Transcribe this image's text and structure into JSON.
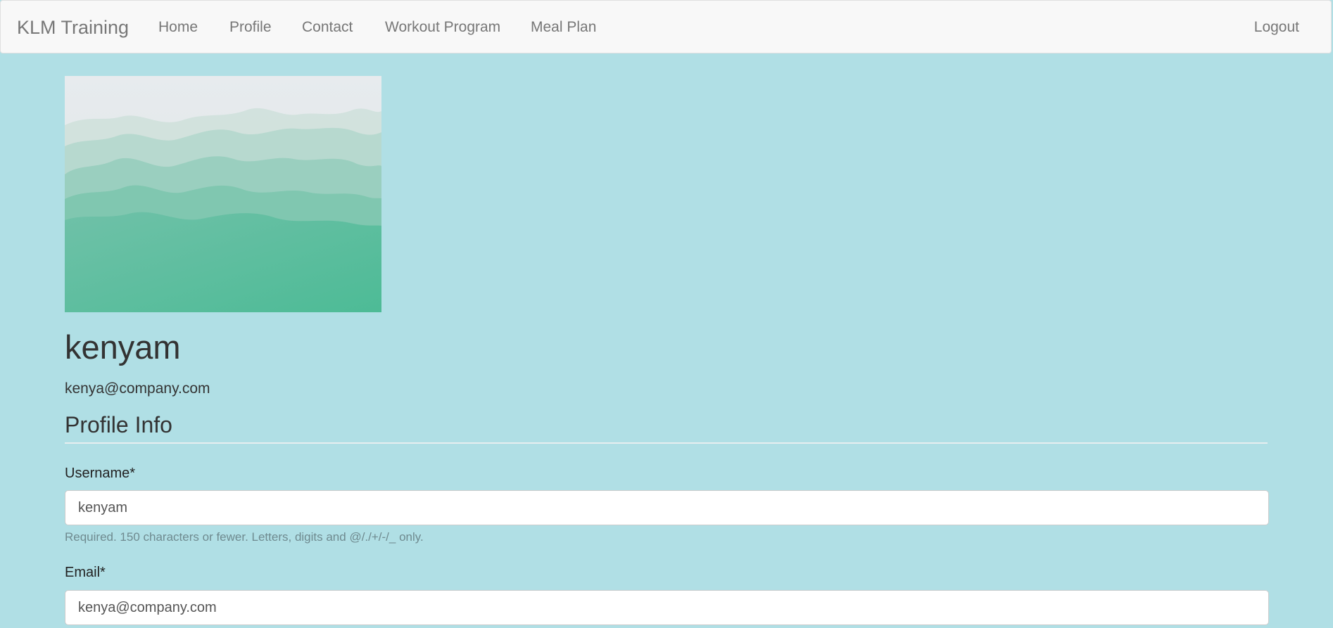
{
  "navbar": {
    "brand": "KLM Training",
    "links": [
      "Home",
      "Profile",
      "Contact",
      "Workout Program",
      "Meal Plan"
    ],
    "logout": "Logout"
  },
  "profile": {
    "image": "mountain-landscape-image",
    "username": "kenyam",
    "email": "kenya@company.com"
  },
  "form": {
    "section_title": "Profile Info",
    "username_label": "Username*",
    "username_value": "kenyam",
    "username_help": "Required. 150 characters or fewer. Letters, digits and @/./+/-/_ only.",
    "email_label": "Email*",
    "email_value": "kenya@company.com"
  },
  "colors": {
    "page_background": "#b0dfe5",
    "navbar_background": "#f8f8f8"
  }
}
